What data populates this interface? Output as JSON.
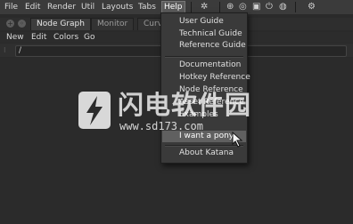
{
  "menubar": {
    "items": [
      "File",
      "Edit",
      "Render",
      "Util",
      "Layouts",
      "Tabs",
      "Help"
    ],
    "active_index": 6
  },
  "tabs": [
    "Node Graph",
    "Monitor",
    "Curv"
  ],
  "node_graph_menu": [
    "New",
    "Edit",
    "Colors",
    "Go"
  ],
  "path": {
    "value": "/"
  },
  "help_menu": {
    "groups": [
      [
        "User Guide",
        "Technical Guide",
        "Reference Guide"
      ],
      [
        "Documentation",
        "Hotkey Reference",
        "Node Reference",
        "Asset Reference",
        "Examples",
        "I want a pony"
      ],
      [
        "About Katana"
      ]
    ],
    "hovered": "I want a pony"
  },
  "watermark": {
    "title": "闪电软件园",
    "url": "www.sd173.com"
  },
  "colors": {
    "background": "#2a2a2a",
    "menubar": "#3b3b3b",
    "menu": "#3a3a3a",
    "highlight": "#606060"
  },
  "icons": [
    "gear-icon",
    "crosshair-icon",
    "render-icon",
    "camera-icon",
    "power-icon",
    "bug-icon"
  ]
}
